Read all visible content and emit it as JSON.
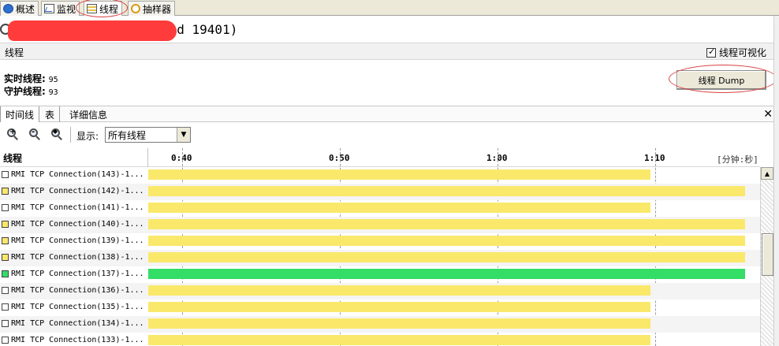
{
  "tabs": [
    {
      "label": "概述",
      "icon": "info-icon"
    },
    {
      "label": "监视",
      "icon": "monitor-icon"
    },
    {
      "label": "线程",
      "icon": "threads-icon"
    },
    {
      "label": "抽样器",
      "icon": "sampler-icon"
    }
  ],
  "title": "pid 19401)",
  "panel": {
    "title": "线程",
    "visualization_label": "线程可视化",
    "visualization_checked": true
  },
  "stats": {
    "live_label": "实时线程:",
    "live_value": "95",
    "daemon_label": "守护线程:",
    "daemon_value": "93"
  },
  "dump_button": "线程 Dump",
  "subtabs": [
    "时间线",
    "表",
    "详细信息"
  ],
  "toolbar": {
    "show_label": "显示:",
    "filter_value": "所有线程"
  },
  "timeline": {
    "column_label": "线程",
    "ticks": [
      "0:40",
      "0:50",
      "1:00",
      "1:10"
    ],
    "unit_label": "[分钟:秒]"
  },
  "colors": {
    "waiting": "#fae86b",
    "running": "#33dd66",
    "highlight": "#d94040"
  },
  "threads": [
    {
      "name": "RMI TCP Connection(143)-1...",
      "state": "empty",
      "bar_end": "1:09.7"
    },
    {
      "name": "RMI TCP Connection(142)-1...",
      "state": "waiting",
      "bar_end": "1:15.7"
    },
    {
      "name": "RMI TCP Connection(141)-1...",
      "state": "empty",
      "bar_end": "1:09.7"
    },
    {
      "name": "RMI TCP Connection(140)-1...",
      "state": "waiting",
      "bar_end": "1:15.7"
    },
    {
      "name": "RMI TCP Connection(139)-1...",
      "state": "waiting",
      "bar_end": "1:15.7"
    },
    {
      "name": "RMI TCP Connection(138)-1...",
      "state": "waiting",
      "bar_end": "1:15.7"
    },
    {
      "name": "RMI TCP Connection(137)-1...",
      "state": "running",
      "bar_end": "1:15.7"
    },
    {
      "name": "RMI TCP Connection(136)-1...",
      "state": "empty",
      "bar_end": "1:09.7"
    },
    {
      "name": "RMI TCP Connection(135)-1...",
      "state": "empty",
      "bar_end": "1:09.7"
    },
    {
      "name": "RMI TCP Connection(134)-1...",
      "state": "empty",
      "bar_end": "1:09.7"
    },
    {
      "name": "RMI TCP Connection(133)-1...",
      "state": "empty",
      "bar_end": "1:09.7"
    }
  ]
}
